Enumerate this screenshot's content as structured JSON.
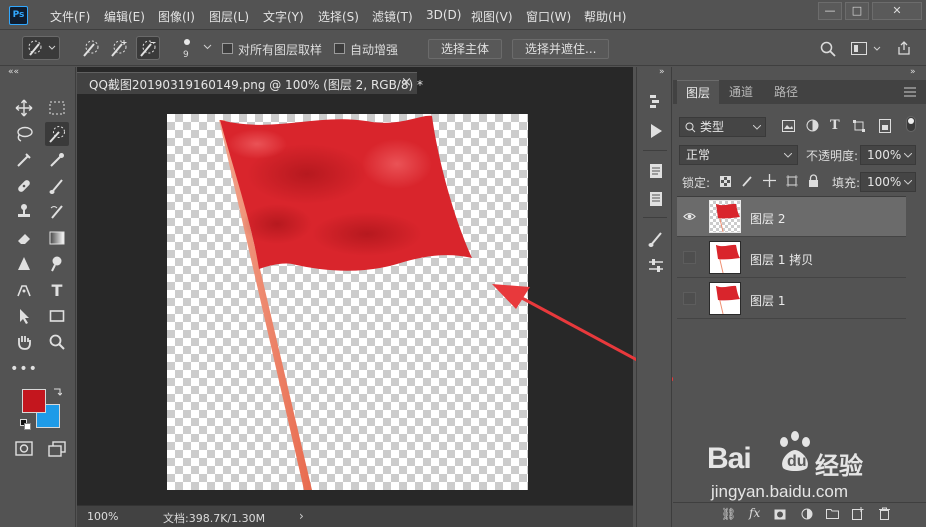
{
  "app": {
    "logo": "Ps"
  },
  "menu": [
    "文件(F)",
    "编辑(E)",
    "图像(I)",
    "图层(L)",
    "文字(Y)",
    "选择(S)",
    "滤镜(T)",
    "3D(D)",
    "视图(V)",
    "窗口(W)",
    "帮助(H)"
  ],
  "window_controls": {
    "minimize": "—",
    "maximize": "□",
    "close": "✕"
  },
  "options": {
    "brush_size": "9",
    "sample_all_layers": "对所有图层取样",
    "auto_enhance": "自动增强",
    "select_subject": "选择主体",
    "select_and_mask": "选择并遮住..."
  },
  "document": {
    "tab_title": "QQ截图20190319160149.png @ 100% (图层 2, RGB/8) *",
    "tab_close": "×",
    "zoom": "100%",
    "doc_info": "文档:398.7K/1.30M",
    "arrow": "›"
  },
  "layers_panel": {
    "tabs": [
      "图层",
      "通道",
      "路径"
    ],
    "filter_kind": "类型",
    "blend_mode": "正常",
    "opacity_label": "不透明度:",
    "opacity_value": "100%",
    "lock_label": "锁定:",
    "fill_label": "填充:",
    "fill_value": "100%",
    "layers": [
      {
        "name": "图层 2",
        "visible": true,
        "selected": true
      },
      {
        "name": "图层 1 拷贝",
        "visible": false,
        "selected": false
      },
      {
        "name": "图层 1",
        "visible": false,
        "selected": false
      }
    ]
  },
  "watermark": {
    "brand": "Bai",
    "brand2": "du",
    "site_cn": "经验",
    "url": "jingyan.baidu.com"
  },
  "colors": {
    "foreground": "#c4161e",
    "background": "#1e9be8",
    "flag": "#d9252c",
    "arrow": "#e8393c"
  }
}
